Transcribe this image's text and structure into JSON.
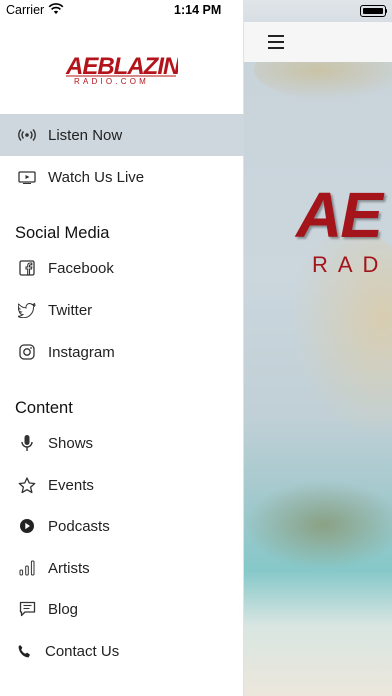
{
  "status_bar": {
    "carrier": "Carrier",
    "time": "1:14 PM"
  },
  "brand": {
    "name": "AEBLAZIN",
    "sub": "RADIO.COM",
    "color": "#b3141b"
  },
  "colors": {
    "active_row": "#cfd7de",
    "text": "#222222"
  },
  "menu": {
    "primary": [
      {
        "label": "Listen Now",
        "icon": "broadcast-icon",
        "active": true
      },
      {
        "label": "Watch Us Live",
        "icon": "video-icon",
        "active": false
      }
    ],
    "social_title": "Social Media",
    "social": [
      {
        "label": "Facebook",
        "icon": "facebook-icon"
      },
      {
        "label": "Twitter",
        "icon": "twitter-icon"
      },
      {
        "label": "Instagram",
        "icon": "instagram-icon"
      }
    ],
    "content_title": "Content",
    "content": [
      {
        "label": "Shows",
        "icon": "microphone-icon"
      },
      {
        "label": "Events",
        "icon": "star-icon"
      },
      {
        "label": "Podcasts",
        "icon": "play-circle-icon"
      },
      {
        "label": "Artists",
        "icon": "bar-chart-icon"
      },
      {
        "label": "Blog",
        "icon": "chat-icon"
      },
      {
        "label": "Contact Us",
        "icon": "phone-icon"
      }
    ]
  },
  "main": {
    "hero_text": "AE",
    "hero_sub": "RAD"
  }
}
